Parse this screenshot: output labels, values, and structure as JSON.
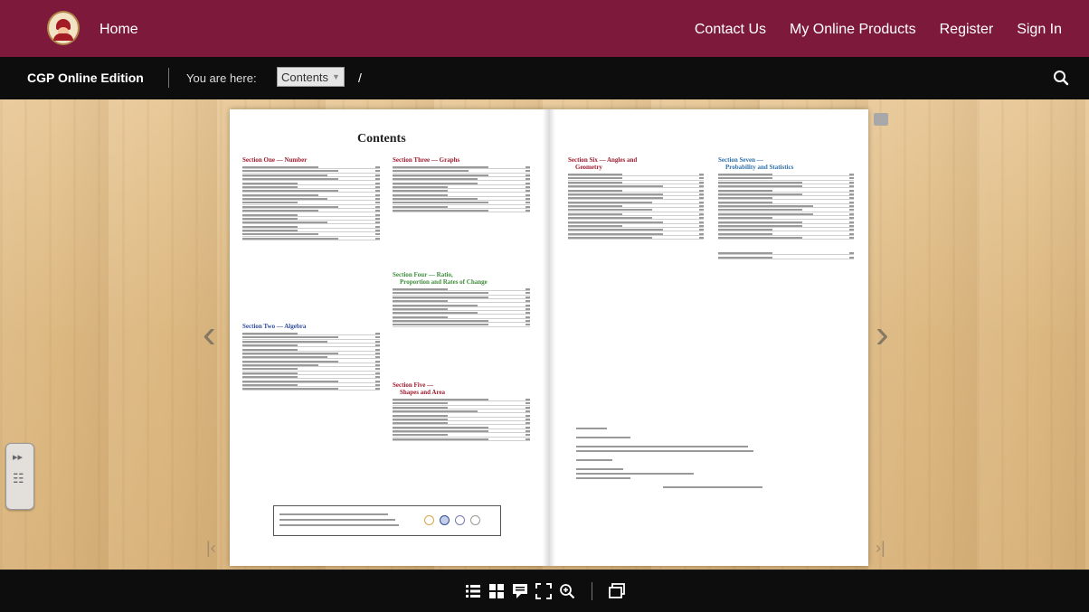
{
  "nav": {
    "home": "Home",
    "contact": "Contact Us",
    "products": "My Online Products",
    "register": "Register",
    "signin": "Sign In"
  },
  "breadcrumb": {
    "edition": "CGP Online Edition",
    "you_are_here": "You are here:",
    "current": "Contents",
    "separator": "/"
  },
  "book": {
    "contents_title": "Contents",
    "sections": [
      {
        "title_lines": [
          "Section One — Number"
        ],
        "color": "#9b1c2e"
      },
      {
        "title_lines": [
          "Section Two — Algebra"
        ],
        "color": "#2e4d9a"
      },
      {
        "title_lines": [
          "Section Three — Graphs"
        ],
        "color": "#9b1c2e"
      },
      {
        "title_lines": [
          "Section Four — Ratio,",
          "Proportion and Rates of Change"
        ],
        "color": "#3f8d3a"
      },
      {
        "title_lines": [
          "Section Five —",
          "Shapes and Area"
        ],
        "color": "#9b1c2e"
      },
      {
        "title_lines": [
          "Section Six — Angles and",
          "Geometry"
        ],
        "color": "#9b1c2e"
      },
      {
        "title_lines": [
          "Section Seven —",
          "Probability and Statistics"
        ],
        "color": "#2e6fa8"
      }
    ]
  },
  "icons": {
    "search": "search-icon",
    "prev": "chevron-left-icon",
    "next": "chevron-right-icon",
    "first": "first-page-icon",
    "last": "last-page-icon",
    "toolbar": [
      "list-icon",
      "grid-icon",
      "comment-icon",
      "fullscreen-icon",
      "zoom-in-icon",
      "slideshow-icon"
    ]
  },
  "colors": {
    "nav_bg": "#7d1a3c",
    "bar_bg": "#0d0d0d"
  }
}
